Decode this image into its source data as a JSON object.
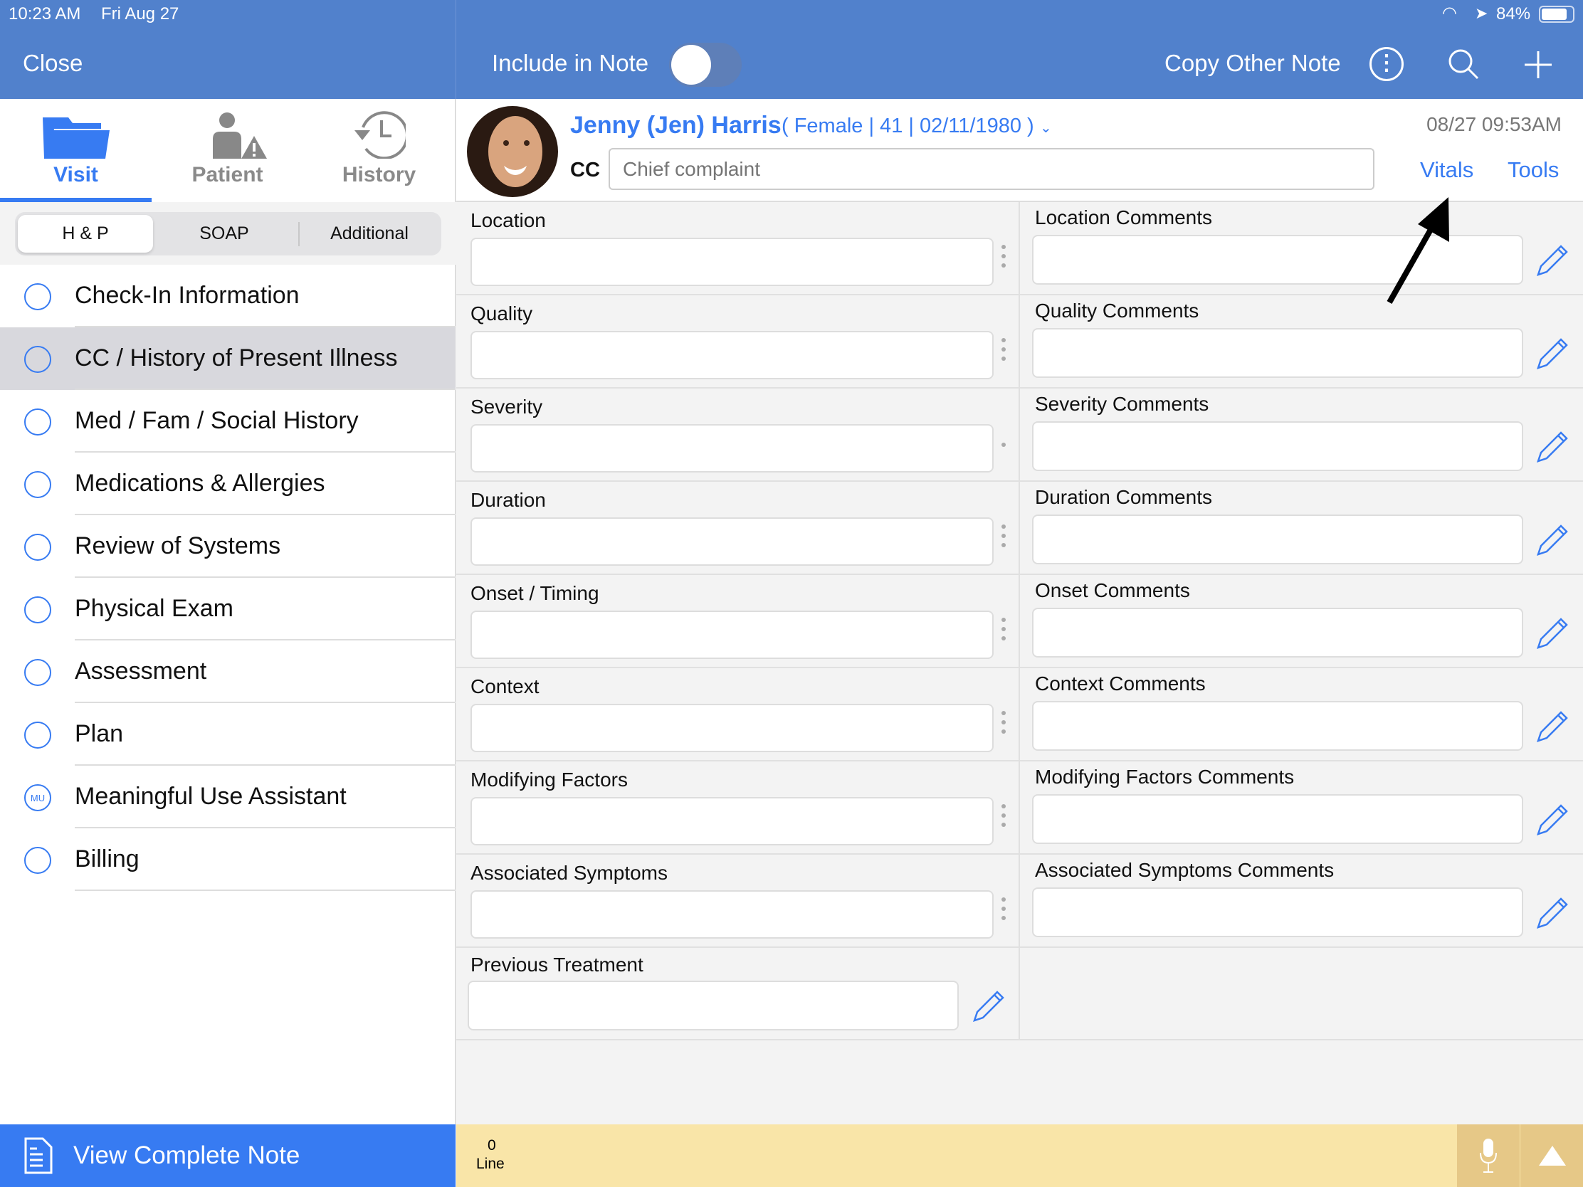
{
  "status_bar": {
    "time": "10:23 AM",
    "date": "Fri Aug 27",
    "battery": "84%"
  },
  "header": {
    "close": "Close",
    "include_in_note": "Include in Note",
    "include_toggle_on": false,
    "copy_other_note": "Copy Other Note"
  },
  "tabs": [
    {
      "label": "Visit",
      "active": true
    },
    {
      "label": "Patient"
    },
    {
      "label": "History"
    }
  ],
  "segments": [
    {
      "label": "H & P",
      "active": true
    },
    {
      "label": "SOAP"
    },
    {
      "label": "Additional"
    }
  ],
  "nav": [
    {
      "label": "Check-In Information",
      "icon": "location-pin-icon"
    },
    {
      "label": "CC / History of Present Illness",
      "icon": "medical-cross-icon",
      "selected": true
    },
    {
      "label": "Med / Fam / Social History",
      "icon": "history-clock-icon"
    },
    {
      "label": "Medications & Allergies",
      "icon": "pill-icon"
    },
    {
      "label": "Review of Systems",
      "icon": "body-figure-icon"
    },
    {
      "label": "Physical Exam",
      "icon": "stethoscope-icon"
    },
    {
      "label": "Assessment",
      "icon": "clipboard-checklist-icon"
    },
    {
      "label": "Plan",
      "icon": "pen-document-icon"
    },
    {
      "label": "Meaningful Use Assistant",
      "icon": "mu-badge-icon",
      "badge_text": "MU"
    },
    {
      "label": "Billing",
      "icon": "dollar-circle-icon"
    }
  ],
  "bottom": {
    "view_complete_note": "View Complete Note",
    "line_count": "0",
    "line_label": "Line"
  },
  "patient": {
    "name": "Jenny (Jen) Harris",
    "details": "( Female | 41 | 02/11/1980 )",
    "timestamp": "08/27 09:53AM",
    "cc_label": "CC",
    "cc_placeholder": "Chief complaint",
    "cc_value": "",
    "vitals": "Vitals",
    "tools": "Tools"
  },
  "form": [
    {
      "left": "Location",
      "right": "Location Comments"
    },
    {
      "left": "Quality",
      "right": "Quality Comments"
    },
    {
      "left": "Severity",
      "right": "Severity Comments"
    },
    {
      "left": "Duration",
      "right": "Duration Comments"
    },
    {
      "left": "Onset / Timing",
      "right": "Onset Comments"
    },
    {
      "left": "Context",
      "right": "Context Comments"
    },
    {
      "left": "Modifying Factors",
      "right": "Modifying Factors Comments"
    },
    {
      "left": "Associated Symptoms",
      "right": "Associated Symptoms Comments"
    }
  ],
  "previous_treatment": "Previous Treatment",
  "colors": {
    "header": "#5181cc",
    "accent": "#377bf2",
    "footer": "#f9e5a8",
    "footer_buttons": "#e6c887"
  }
}
